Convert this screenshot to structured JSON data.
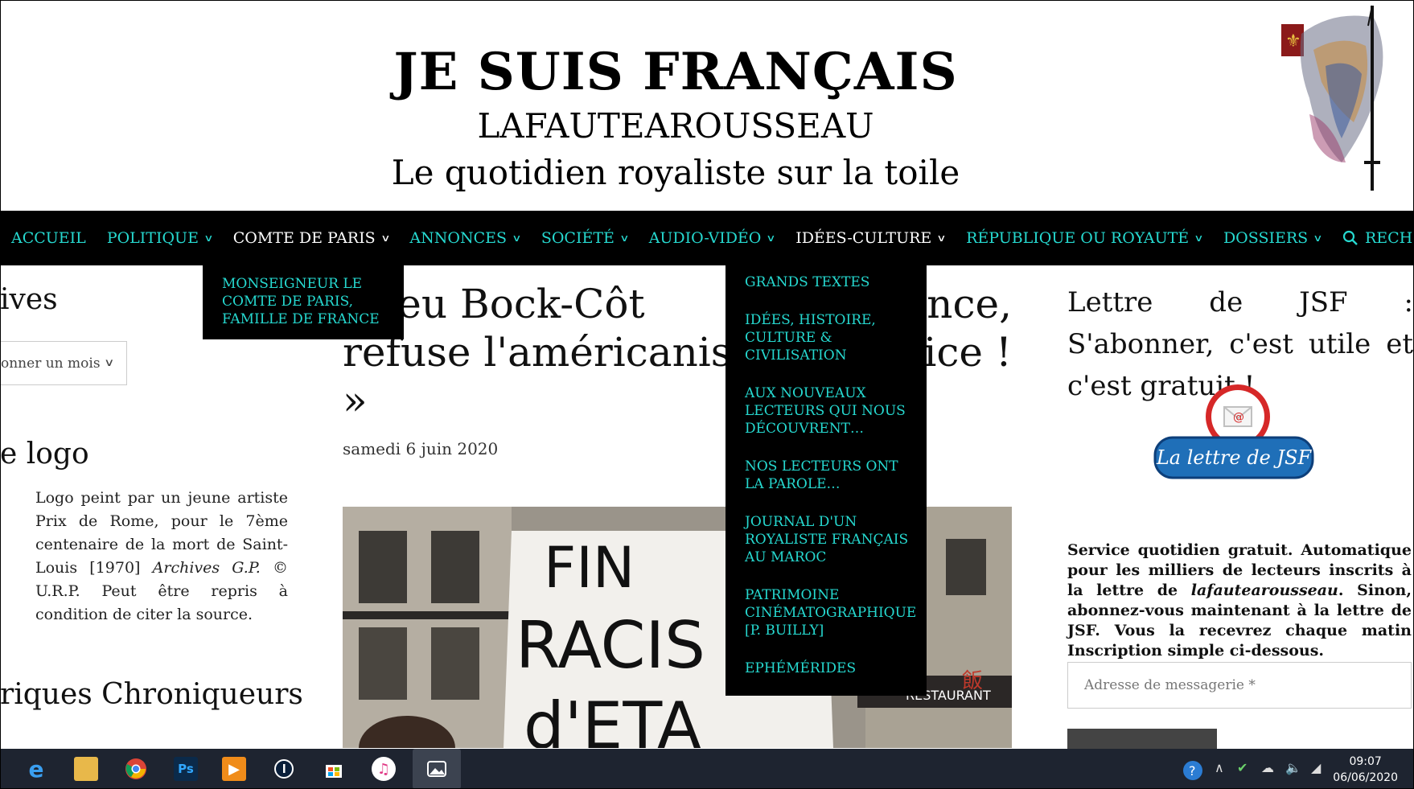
{
  "header": {
    "title": "JE SUIS FRANÇAIS",
    "subtitle1": "LAFAUTEAROUSSEAU",
    "subtitle2": "Le quotidien royaliste sur la toile"
  },
  "nav": {
    "items": [
      {
        "label": "ACCUEIL",
        "has_dropdown": false
      },
      {
        "label": "POLITIQUE",
        "has_dropdown": true
      },
      {
        "label": "COMTE DE PARIS",
        "has_dropdown": true,
        "active": true
      },
      {
        "label": "ANNONCES",
        "has_dropdown": true
      },
      {
        "label": "SOCIÉTÉ",
        "has_dropdown": true
      },
      {
        "label": "AUDIO-VIDÉO",
        "has_dropdown": true
      },
      {
        "label": "IDÉES-CULTURE",
        "has_dropdown": true,
        "active": true
      },
      {
        "label": "RÉPUBLIQUE OU ROYAUTÉ",
        "has_dropdown": true
      },
      {
        "label": "DOSSIERS",
        "has_dropdown": true
      },
      {
        "label": "RECHERCHE",
        "icon": "search-icon"
      }
    ],
    "accent_color": "#26d9d0"
  },
  "dropdown_comte": {
    "items": [
      "MONSEIGNEUR LE COMTE DE PARIS, FAMILLE DE FRANCE"
    ]
  },
  "dropdown_idees": {
    "items": [
      "GRANDS TEXTES",
      "IDÉES, HISTOIRE, CULTURE & CIVILISATION",
      "AUX NOUVEAUX LECTEURS QUI NOUS DÉCOUVRENT…",
      "NOS LECTEURS ONT LA PAROLE…",
      "JOURNAL D'UN ROYALISTE FRANÇAIS AU MAROC",
      "PATRIMOINE CINÉMATOGRAPHIQUE [P. BUILLY]",
      "EPHÉMÉRIDES"
    ]
  },
  "left": {
    "archives_heading": "ives",
    "archives_select": "onner un mois",
    "logo_heading": "e logo",
    "logo_text_a": "Logo peint par un jeune artiste Prix de Rome, pour le 7ème centenaire de la mort de Saint-Louis [1970]",
    "logo_text_em": "Archives G.P.",
    "logo_text_b": " © U.R.P. Peut être repris à condition de citer la source.",
    "chroniqueurs_heading": "riques Chroniqueurs"
  },
  "article": {
    "title_line1": "thieu Bock-Côt",
    "title_line1b": "nce,",
    "title_line2": "refuse l'américanis",
    "title_line2b": "ice !",
    "title_line3": "»",
    "date": "samedi 6 juin 2020",
    "sign_text": "FIN RACIS D'ETAT"
  },
  "right": {
    "newsletter_title": "Lettre de JSF : S'abonner, c'est utile et c'est gratuit !",
    "badge_label": "La lettre de JSF",
    "desc_a": "Service quotidien gratuit. Automatique pour les milliers de lecteurs inscrits à la lettre de ",
    "desc_em": "lafautearousseau",
    "desc_b": ". Sinon, abonnez-vous maintenant à la lettre de JSF. Vous la recevrez chaque matin Inscription simple ci-dessous.",
    "email_placeholder": "Adresse de messagerie *"
  },
  "taskbar": {
    "time": "09:07",
    "date": "06/06/2020",
    "apps": [
      "edge-icon",
      "file-explorer-icon",
      "chrome-icon",
      "photoshop-icon",
      "media-player-icon",
      "app-icon",
      "store-icon",
      "itunes-icon",
      "photos-icon"
    ]
  }
}
